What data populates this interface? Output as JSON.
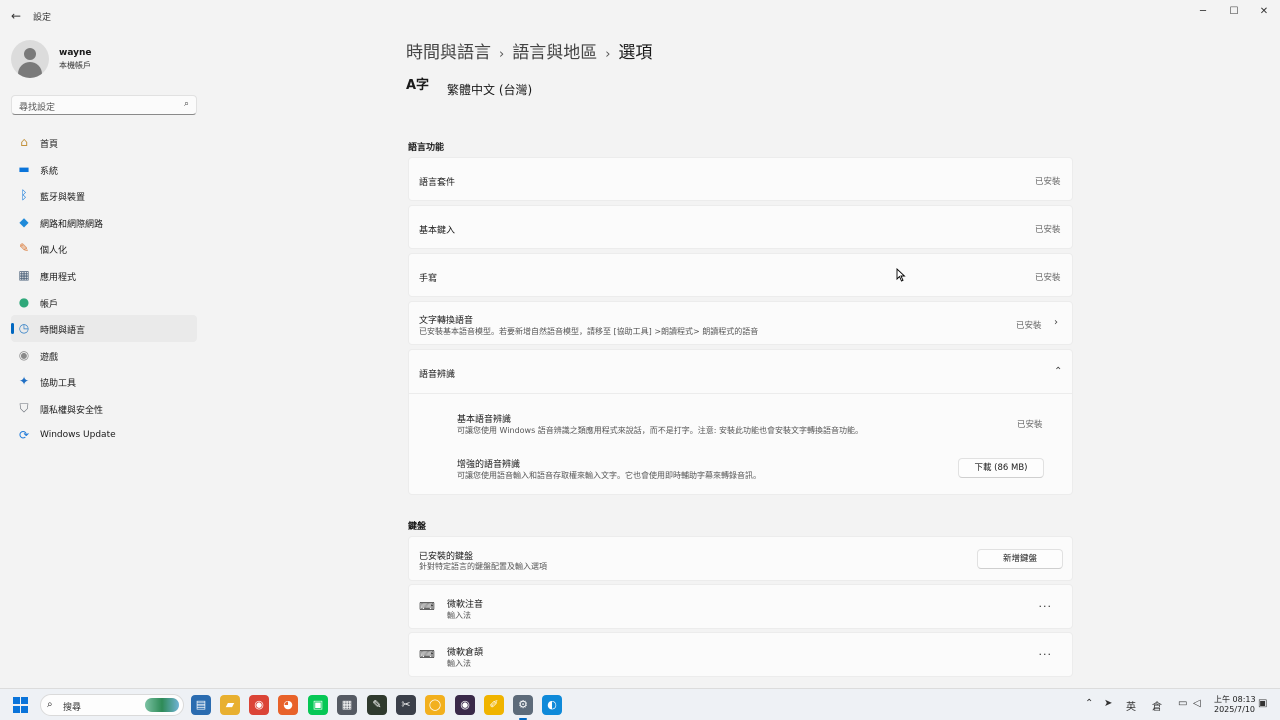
{
  "window": {
    "title": "設定",
    "back_icon": "←",
    "min_icon": "─",
    "max_icon": "☐",
    "close_icon": "✕"
  },
  "profile": {
    "name": "wayne",
    "account_type": "本機帳戶"
  },
  "search": {
    "placeholder": "尋找設定",
    "icon": "⌕"
  },
  "nav": [
    {
      "label": "首頁",
      "icon": "home-icon",
      "glyph": "⌂",
      "color": "#c2913b",
      "active": false
    },
    {
      "label": "系統",
      "icon": "monitor-icon",
      "glyph": "▬",
      "color": "#0a74da",
      "active": false
    },
    {
      "label": "藍牙與裝置",
      "icon": "bluetooth-icon",
      "glyph": "ᛒ",
      "color": "#0a74da",
      "active": false
    },
    {
      "label": "網路和網際網路",
      "icon": "wifi-icon",
      "glyph": "◆",
      "color": "#1f8ad9",
      "active": false
    },
    {
      "label": "個人化",
      "icon": "brush-icon",
      "glyph": "✎",
      "color": "#d9742f",
      "active": false
    },
    {
      "label": "應用程式",
      "icon": "apps-icon",
      "glyph": "▦",
      "color": "#4a5f78",
      "active": false
    },
    {
      "label": "帳戶",
      "icon": "person-icon",
      "glyph": "●",
      "color": "#2fa87a",
      "active": false
    },
    {
      "label": "時間與語言",
      "icon": "globe-clock-icon",
      "glyph": "◷",
      "color": "#2a7bc4",
      "active": true
    },
    {
      "label": "遊戲",
      "icon": "gamepad-icon",
      "glyph": "◉",
      "color": "#8a8a8a",
      "active": false
    },
    {
      "label": "協助工具",
      "icon": "accessibility-icon",
      "glyph": "✦",
      "color": "#1f6fc4",
      "active": false
    },
    {
      "label": "隱私權與安全性",
      "icon": "shield-icon",
      "glyph": "⛉",
      "color": "#6a6f78",
      "active": false
    },
    {
      "label": "Windows Update",
      "icon": "update-icon",
      "glyph": "⟳",
      "color": "#1f7ad9",
      "active": false
    }
  ],
  "breadcrumb": {
    "level1": "時間與語言",
    "level2": "語言與地區",
    "current": "選項",
    "sep": "›"
  },
  "language": {
    "icon_text": "A字",
    "name": "繁體中文 (台灣)"
  },
  "language_features": {
    "title": "語言功能",
    "items": [
      {
        "label": "語言套件",
        "status": "已安裝"
      },
      {
        "label": "基本鍵入",
        "status": "已安裝"
      },
      {
        "label": "手寫",
        "status": "已安裝"
      },
      {
        "label": "文字轉換語音",
        "desc": "已安裝基本語音模型。若要新增自然語音模型，請移至 [協助工具] >朗讀程式> 朗讀程式的語音",
        "status": "已安裝",
        "chevron": "›"
      }
    ],
    "speech": {
      "label": "語音辨識",
      "chevron": "⌃",
      "basic": {
        "label": "基本語音辨識",
        "desc": "可讓您使用 Windows 語音辨識之類應用程式來說話，而不是打字。注意: 安裝此功能也會安裝文字轉換語音功能。",
        "status": "已安裝"
      },
      "enhanced": {
        "label": "增強的語音辨識",
        "desc": "可讓您使用語音輸入和語音存取權來輸入文字。它也會使用即時輔助字幕來轉錄音訊。",
        "button": "下載 (86 MB)"
      }
    }
  },
  "keyboards": {
    "title": "鍵盤",
    "installed": {
      "label": "已安裝的鍵盤",
      "desc": "針對特定語言的鍵盤配置及輸入選項",
      "button": "新增鍵盤"
    },
    "items": [
      {
        "label": "微軟注音",
        "sub": "輸入法",
        "more": "···"
      },
      {
        "label": "微軟倉頡",
        "sub": "輸入法",
        "more": "···"
      }
    ]
  },
  "taskbar": {
    "search_placeholder": "搜尋",
    "apps": [
      {
        "name": "notepad-icon",
        "glyph": "▤",
        "color": "#2b6cb0"
      },
      {
        "name": "file-explorer-icon",
        "glyph": "▰",
        "color": "#e8b030"
      },
      {
        "name": "chrome-icon",
        "glyph": "◉",
        "color": "#db4437"
      },
      {
        "name": "firefox-icon",
        "glyph": "◕",
        "color": "#e8622a"
      },
      {
        "name": "line-icon",
        "glyph": "▣",
        "color": "#06c755"
      },
      {
        "name": "calculator-icon",
        "glyph": "▦",
        "color": "#555a63"
      },
      {
        "name": "sticky-notes-icon",
        "glyph": "✎",
        "color": "#2f3a2e"
      },
      {
        "name": "snipping-tool-icon",
        "glyph": "✂",
        "color": "#3a3f4a"
      },
      {
        "name": "app-orange-icon",
        "glyph": "◯",
        "color": "#f2b01e"
      },
      {
        "name": "app-circle-icon",
        "glyph": "◉",
        "color": "#3a2a4a"
      },
      {
        "name": "app-pen-icon",
        "glyph": "✐",
        "color": "#f0b400"
      },
      {
        "name": "settings-icon",
        "glyph": "⚙",
        "color": "#5d6b7a"
      },
      {
        "name": "edge-icon",
        "glyph": "◐",
        "color": "#0f8ad9"
      }
    ],
    "tray": {
      "chevron": "⌃",
      "location": "➤",
      "ime": "英",
      "ime2": "倉",
      "network": "▭",
      "volume": "◁",
      "notification": "▣"
    },
    "time": "上午 08:13",
    "date": "2025/7/10"
  }
}
